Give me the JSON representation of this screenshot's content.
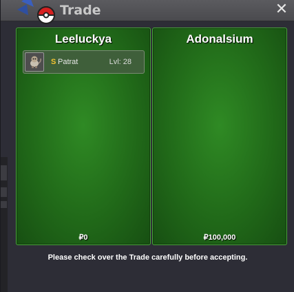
{
  "window": {
    "title": "Trade",
    "close_glyph": "✕"
  },
  "trade": {
    "left": {
      "player": "Leeluckya",
      "items": [
        {
          "icon": "patrat-sprite-icon",
          "currency_glyph": "S",
          "name": "Patrat",
          "level": "Lvl: 28"
        }
      ],
      "money": "₽0"
    },
    "right": {
      "player": "Adonalsium",
      "items": [],
      "money": "₽100,000"
    }
  },
  "notice": "Please check over the Trade carefully before accepting.",
  "colors": {
    "panel_green": "#216a19",
    "panel_border": "#4aa63c",
    "coin_gold": "#f4c430",
    "window_bg": "#2d2d36"
  }
}
